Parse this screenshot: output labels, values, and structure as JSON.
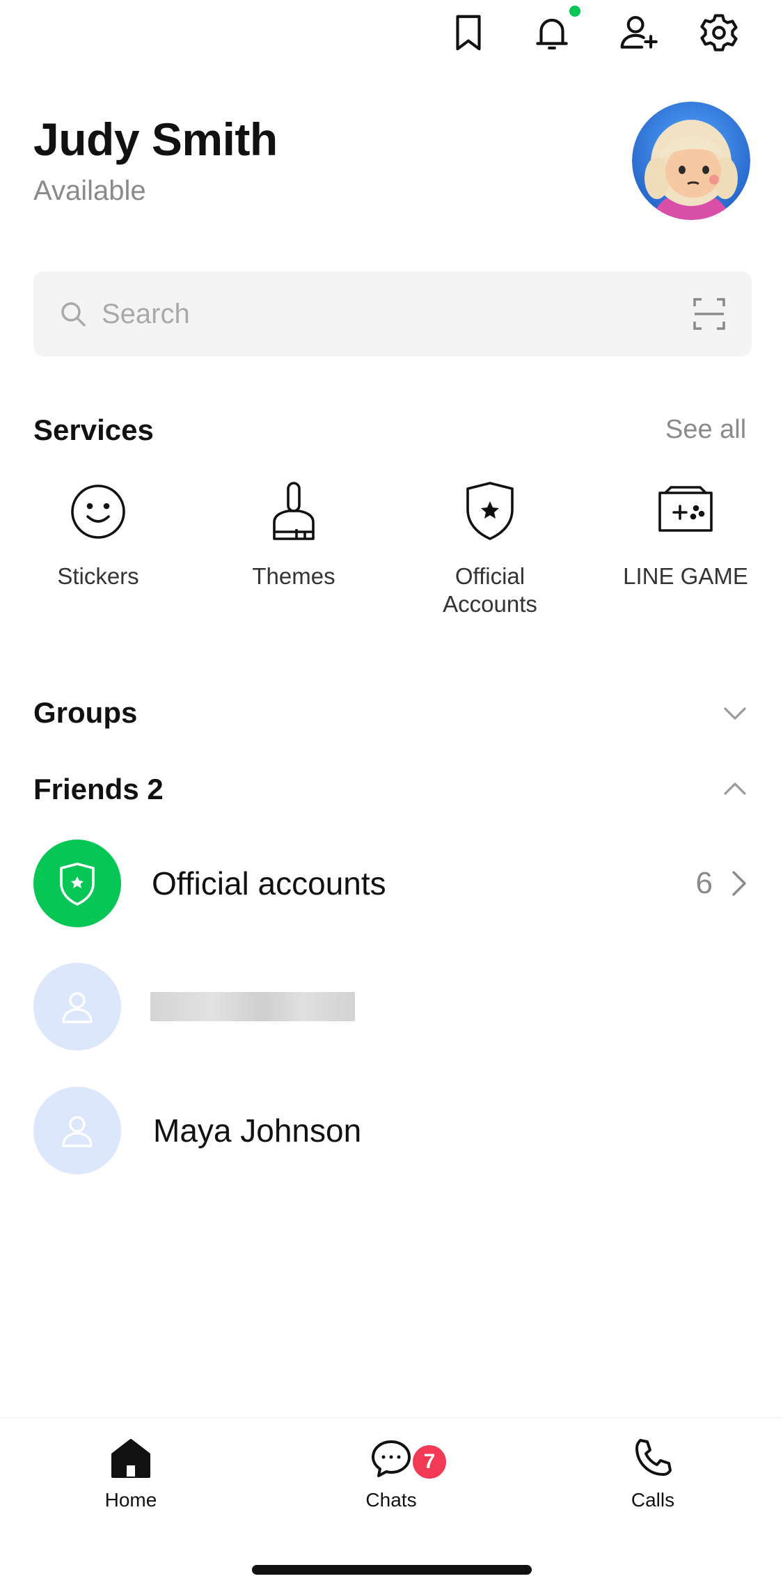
{
  "header": {
    "icons": [
      "bookmark-icon",
      "bell-icon",
      "add-friend-icon",
      "gear-icon"
    ],
    "notification_dot_color": "#06c755"
  },
  "profile": {
    "name": "Judy Smith",
    "status": "Available"
  },
  "search": {
    "placeholder": "Search"
  },
  "services": {
    "title": "Services",
    "see_all": "See all",
    "items": [
      {
        "label": "Stickers",
        "icon": "smiley-icon"
      },
      {
        "label": "Themes",
        "icon": "brush-icon"
      },
      {
        "label": "Official Accounts",
        "icon": "shield-star-icon"
      },
      {
        "label": "LINE GAME",
        "icon": "game-controller-icon"
      }
    ]
  },
  "groups": {
    "title": "Groups"
  },
  "friends": {
    "title": "Friends 2",
    "official": {
      "label": "Official accounts",
      "count": "6"
    },
    "items": [
      {
        "name": ""
      },
      {
        "name": "Maya Johnson"
      }
    ]
  },
  "bottom_nav": {
    "items": [
      {
        "label": "Home",
        "icon": "home-icon"
      },
      {
        "label": "Chats",
        "icon": "chat-bubble-icon",
        "badge": "7"
      },
      {
        "label": "Calls",
        "icon": "phone-icon"
      }
    ]
  },
  "colors": {
    "accent_green": "#06c755",
    "badge_red": "#f23a55",
    "avatar_placeholder": "#dce7fb"
  }
}
